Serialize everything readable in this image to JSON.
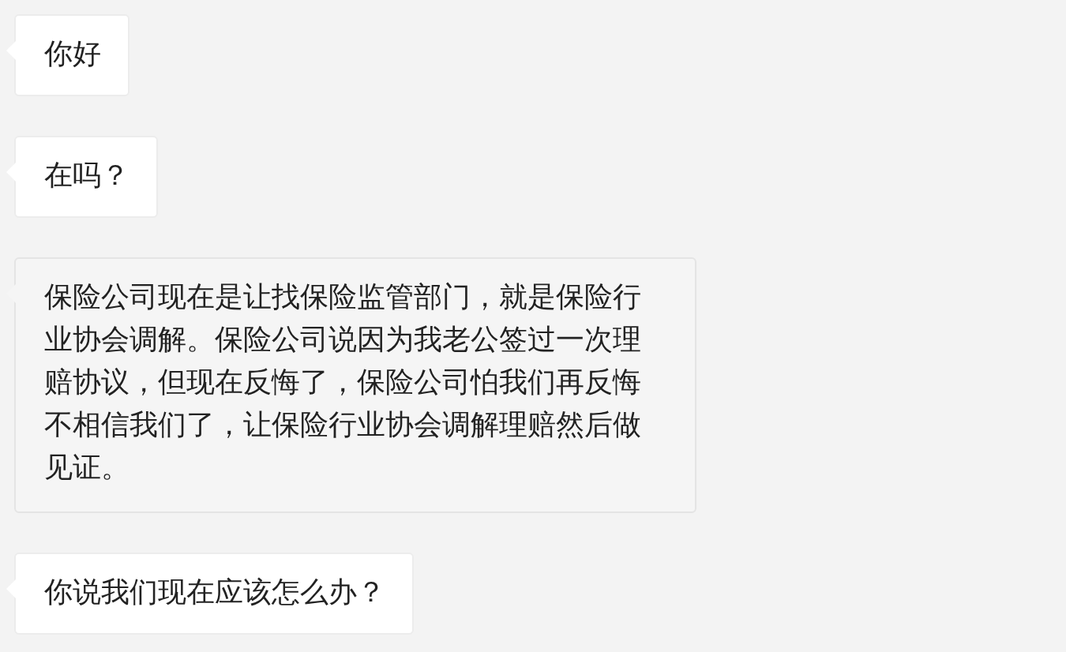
{
  "messages": [
    {
      "text": "你好",
      "highlighted": false
    },
    {
      "text": "在吗？",
      "highlighted": false
    },
    {
      "text": "保险公司现在是让找保险监管部门，就是保险行业协会调解。保险公司说因为我老公签过一次理赔协议，但现在反悔了，保险公司怕我们再反悔不相信我们了，让保险行业协会调解理赔然后做见证。",
      "highlighted": true
    },
    {
      "text": "你说我们现在应该怎么办？",
      "highlighted": false
    }
  ]
}
